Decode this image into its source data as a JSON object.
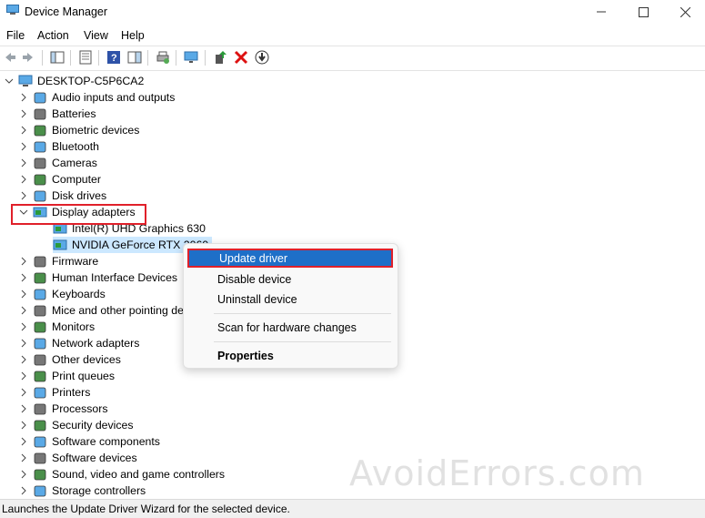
{
  "window": {
    "title": "Device Manager"
  },
  "menu": [
    "File",
    "Action",
    "View",
    "Help"
  ],
  "tree": {
    "root": "DESKTOP-C5P6CA2",
    "categories": [
      "Audio inputs and outputs",
      "Batteries",
      "Biometric devices",
      "Bluetooth",
      "Cameras",
      "Computer",
      "Disk drives",
      "Display adapters"
    ],
    "display_children": [
      "Intel(R) UHD Graphics 630",
      "NVIDIA GeForce RTX 2060"
    ],
    "categories_after": [
      "Firmware",
      "Human Interface Devices",
      "Keyboards",
      "Mice and other pointing devices",
      "Monitors",
      "Network adapters",
      "Other devices",
      "Print queues",
      "Printers",
      "Processors",
      "Security devices",
      "Software components",
      "Software devices",
      "Sound, video and game controllers",
      "Storage controllers"
    ]
  },
  "context_menu": {
    "update_driver": "Update driver",
    "disable_device": "Disable device",
    "uninstall_device": "Uninstall device",
    "scan": "Scan for hardware changes",
    "properties": "Properties"
  },
  "status": "Launches the Update Driver Wizard for the selected device.",
  "watermark": "AvoidErrors.com",
  "colors": {
    "accent": "#1e6fc8",
    "highlight": "#e0202a",
    "selection": "#cce8ff"
  }
}
